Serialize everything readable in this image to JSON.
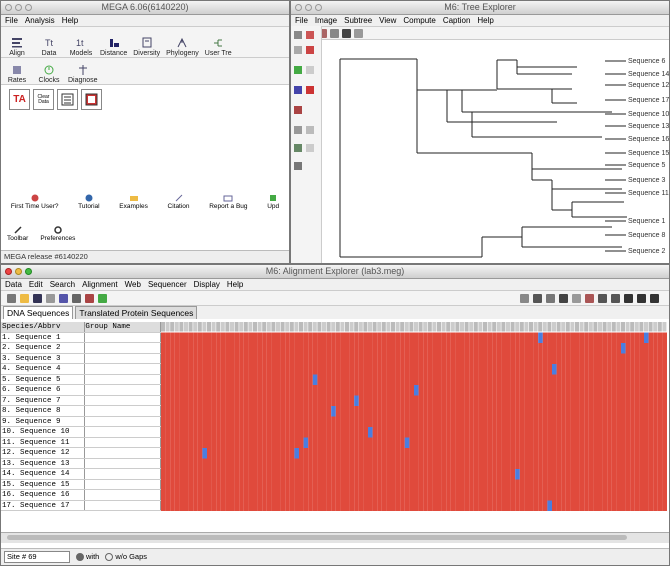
{
  "mega": {
    "title": "MEGA 6.06(6140220)",
    "menu": [
      "File",
      "Analysis",
      "Help"
    ],
    "ribbon": [
      "Align",
      "Data",
      "Models",
      "Distance",
      "Diversity",
      "Phylogeny",
      "User Tre"
    ],
    "ribbon2": [
      "Rates",
      "Clocks",
      "Diagnose"
    ],
    "bigicons": [
      "TA",
      "Clear Data"
    ],
    "links": [
      "First Time User?",
      "Tutorial",
      "Examples",
      "Citation",
      "Report a Bug",
      "Upd"
    ],
    "tools": [
      "Toolbar",
      "Preferences"
    ],
    "status": "MEGA release #6140220"
  },
  "tree": {
    "title": "M6: Tree Explorer",
    "menu": [
      "File",
      "Image",
      "Subtree",
      "View",
      "Compute",
      "Caption",
      "Help"
    ],
    "taxa": [
      "Sequence 6",
      "Sequence 14",
      "Sequence 12",
      "Sequence 17",
      "Sequence 10",
      "Sequence 13",
      "Sequence 16",
      "Sequence 15",
      "Sequence 5",
      "Sequence 3",
      "Sequence 11",
      "Sequence 1",
      "Sequence 8",
      "Sequence 2"
    ]
  },
  "alignment": {
    "title": "M6: Alignment Explorer (lab3.meg)",
    "menu": [
      "Data",
      "Edit",
      "Search",
      "Alignment",
      "Web",
      "Sequencer",
      "Display",
      "Help"
    ],
    "tabs": [
      "DNA Sequences",
      "Translated Protein Sequences"
    ],
    "header": {
      "species": "Species/Abbrv",
      "group": "Group Name"
    },
    "sequences": [
      "1. Sequence 1",
      "2. Sequence 2",
      "3. Sequence 3",
      "4. Sequence 4",
      "5. Sequence 5",
      "6. Sequence 6",
      "7. Sequence 7",
      "8. Sequence 8",
      "9. Sequence 9",
      "10. Sequence 10",
      "11. Sequence 11",
      "12. Sequence 12",
      "13. Sequence 13",
      "14. Sequence 14",
      "15. Sequence 15",
      "16. Sequence 16",
      "17. Sequence 17"
    ],
    "status": {
      "site": "Site # 69",
      "with": "with",
      "without": "w/o Gaps"
    },
    "colors": {
      "A": "#e04a3c",
      "C": "#4a7ee0",
      "G": "#b248c8",
      "T": "#3cc850"
    }
  }
}
